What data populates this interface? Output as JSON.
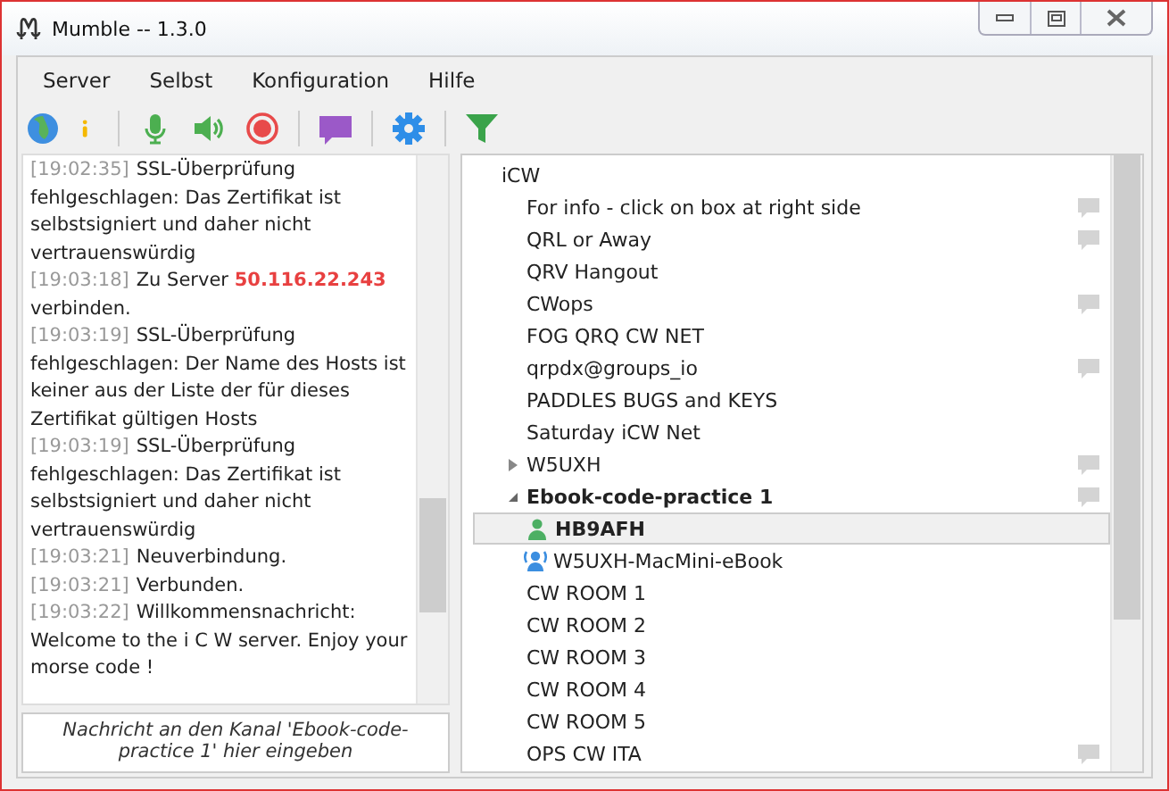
{
  "window": {
    "title": "Mumble -- 1.3.0"
  },
  "menu": [
    "Server",
    "Selbst",
    "Konfiguration",
    "Hilfe"
  ],
  "log": [
    {
      "time": "[19:02:35]",
      "segments": [
        {
          "kind": "text",
          "text": "SSL-Überprüfung fehlgeschlagen: Das Zertifikat ist selbstsigniert und daher nicht vertrauenswürdig"
        }
      ]
    },
    {
      "time": "[19:03:18]",
      "segments": [
        {
          "kind": "text",
          "text": "Zu Server "
        },
        {
          "kind": "address",
          "text": "50.116.22.243"
        },
        {
          "kind": "text",
          "text": " verbinden."
        }
      ]
    },
    {
      "time": "[19:03:19]",
      "segments": [
        {
          "kind": "text",
          "text": "SSL-Überprüfung fehlgeschlagen: Der Name des Hosts ist keiner aus der Liste der für dieses Zertifikat gültigen Hosts"
        }
      ]
    },
    {
      "time": "[19:03:19]",
      "segments": [
        {
          "kind": "text",
          "text": "SSL-Überprüfung fehlgeschlagen: Das Zertifikat ist selbstsigniert und daher nicht vertrauenswürdig"
        }
      ]
    },
    {
      "time": "[19:03:21]",
      "segments": [
        {
          "kind": "text",
          "text": "Neuverbindung."
        }
      ]
    },
    {
      "time": "[19:03:21]",
      "segments": [
        {
          "kind": "text",
          "text": "Verbunden."
        }
      ]
    },
    {
      "time": "[19:03:22]",
      "segments": [
        {
          "kind": "text",
          "text": "Willkommensnachricht: Welcome to the i C W server. Enjoy your morse code !"
        }
      ]
    }
  ],
  "message_input": {
    "placeholder": "Nachricht an den Kanal 'Ebook-code-practice 1' hier eingeben"
  },
  "tree": {
    "kind": "channel",
    "name": "iCW",
    "comment": false,
    "current": false,
    "children": [
      {
        "kind": "channel",
        "name": "For info - click on box at right side",
        "comment": true,
        "current": false
      },
      {
        "kind": "channel",
        "name": "QRL or Away",
        "comment": true,
        "current": false
      },
      {
        "kind": "channel",
        "name": "QRV Hangout",
        "comment": false,
        "current": false
      },
      {
        "kind": "channel",
        "name": "CWops",
        "comment": true,
        "current": false
      },
      {
        "kind": "channel",
        "name": "FOG QRQ CW NET",
        "comment": false,
        "current": false
      },
      {
        "kind": "channel",
        "name": "qrpdx@groups_io",
        "comment": true,
        "current": false
      },
      {
        "kind": "channel",
        "name": "PADDLES BUGS and KEYS",
        "comment": false,
        "current": false
      },
      {
        "kind": "channel",
        "name": "Saturday iCW Net",
        "comment": false,
        "current": false
      },
      {
        "kind": "channel",
        "name": "W5UXH",
        "comment": true,
        "current": false,
        "expanded": false
      },
      {
        "kind": "channel",
        "name": "Ebook-code-practice 1",
        "comment": true,
        "current": true,
        "expanded": true,
        "children": [
          {
            "kind": "user",
            "name": "HB9AFH",
            "self": true,
            "talking": false,
            "selected": true
          },
          {
            "kind": "user",
            "name": "W5UXH-MacMini-eBook",
            "self": false,
            "talking": true,
            "selected": false
          }
        ]
      },
      {
        "kind": "channel",
        "name": "CW ROOM 1",
        "comment": false,
        "current": false
      },
      {
        "kind": "channel",
        "name": "CW ROOM 2",
        "comment": false,
        "current": false
      },
      {
        "kind": "channel",
        "name": "CW ROOM 3",
        "comment": false,
        "current": false
      },
      {
        "kind": "channel",
        "name": "CW ROOM 4",
        "comment": false,
        "current": false
      },
      {
        "kind": "channel",
        "name": "CW ROOM 5",
        "comment": false,
        "current": false
      },
      {
        "kind": "channel",
        "name": "OPS CW ITA",
        "comment": true,
        "current": false
      }
    ]
  }
}
